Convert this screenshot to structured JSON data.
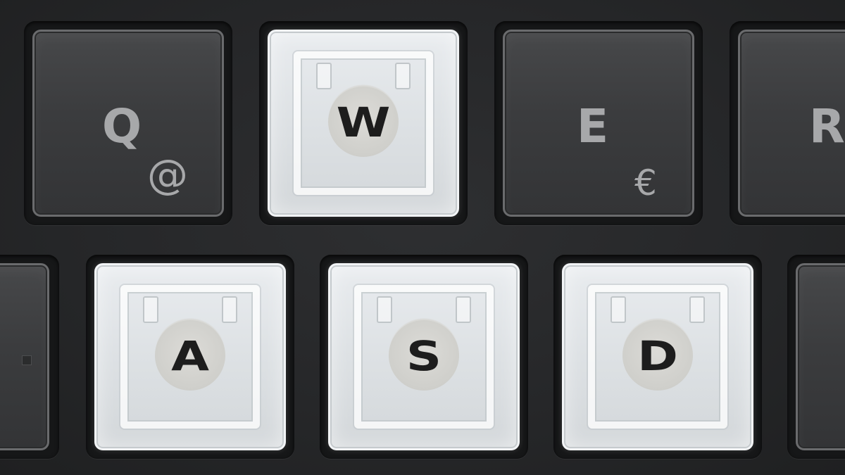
{
  "keys": {
    "q": {
      "label": "Q",
      "alt": "@"
    },
    "w": {
      "label": "W"
    },
    "e": {
      "label": "E",
      "alt": "€"
    },
    "r": {
      "label": "R"
    },
    "a": {
      "label": "A"
    },
    "s": {
      "label": "S"
    },
    "d": {
      "label": "D"
    }
  },
  "colors": {
    "frame": "#232425",
    "dark_keycap": "#3b3c3e",
    "dark_legend": "#a7a8aa",
    "clear_keycap": "#dde1e4",
    "clear_legend": "#1d1d1d"
  }
}
